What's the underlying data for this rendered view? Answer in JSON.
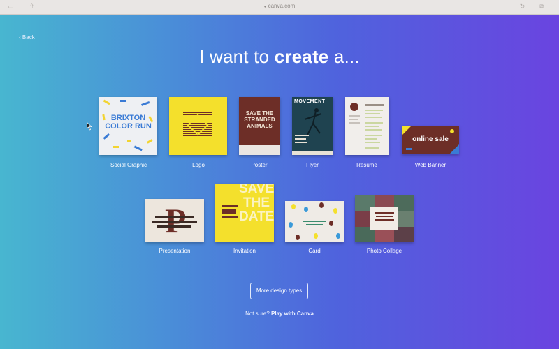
{
  "browser": {
    "url": "canva.com"
  },
  "nav": {
    "back_label": "Back"
  },
  "headline": {
    "prefix": "I want to ",
    "bold": "create",
    "suffix": " a..."
  },
  "designs": [
    {
      "label": "Social Graphic",
      "thumb_text": "BRIXTON COLOR RUN"
    },
    {
      "label": "Logo",
      "thumb_text": ""
    },
    {
      "label": "Poster",
      "thumb_text": "SAVE THE STRANDED ANIMALS"
    },
    {
      "label": "Flyer",
      "thumb_text": "MOVEMENT"
    },
    {
      "label": "Resume",
      "thumb_text": ""
    },
    {
      "label": "Web Banner",
      "thumb_text": "online sale"
    },
    {
      "label": "Presentation",
      "thumb_text": "P"
    },
    {
      "label": "Invitation",
      "thumb_text": "SAVE THE DATE"
    },
    {
      "label": "Card",
      "thumb_text": ""
    },
    {
      "label": "Photo Collage",
      "thumb_text": ""
    }
  ],
  "more_button": {
    "label": "More design types"
  },
  "footer": {
    "prefix": "Not sure?",
    "link": "Play with Canva"
  },
  "colors": {
    "gradient_start": "#48b6d0",
    "gradient_end": "#6a44e0",
    "canva_yellow": "#f4e02c",
    "canva_maroon": "#6d2e27"
  }
}
